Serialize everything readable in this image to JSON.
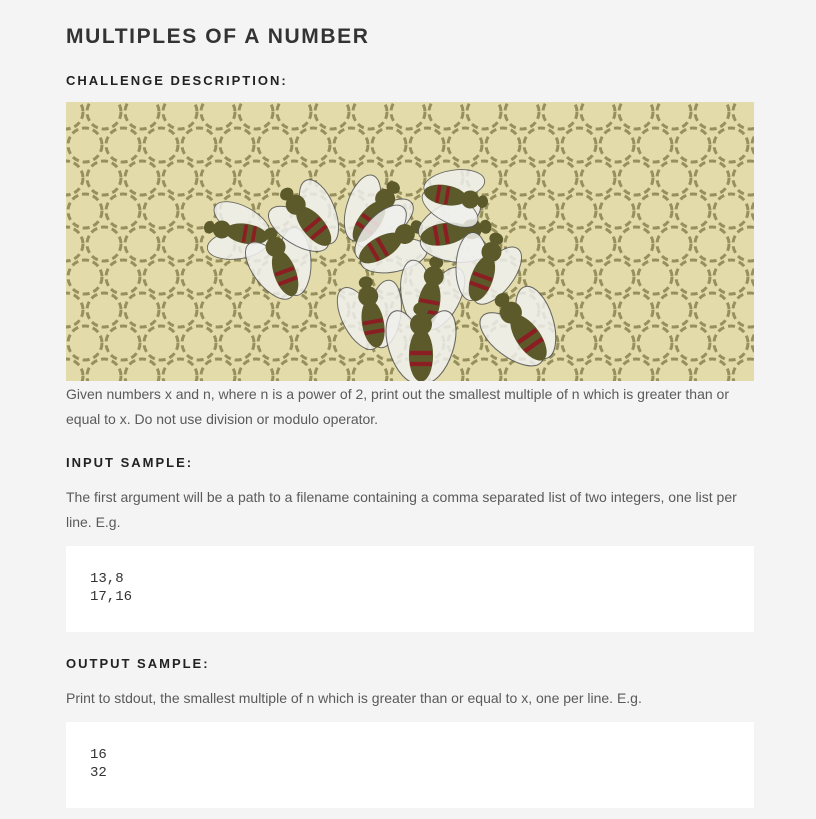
{
  "title": "MULTIPLES OF A NUMBER",
  "description": {
    "heading": "CHALLENGE DESCRIPTION:",
    "text": "Given numbers x and n, where n is a power of 2, print out the smallest multiple of n which is greater than or equal to x. Do not use division or modulo operator."
  },
  "input": {
    "heading": "INPUT SAMPLE:",
    "text": "The first argument will be a path to a filename containing a comma separated list of two integers, one list per line. E.g.",
    "lines": [
      "13,8",
      "17,16"
    ]
  },
  "output": {
    "heading": "OUTPUT SAMPLE:",
    "text": "Print to stdout, the smallest multiple of n which is greater than or equal to x, one per line. E.g.",
    "lines": [
      "16",
      "32"
    ]
  },
  "colors": {
    "page_bg": "#f4f4f4",
    "banner_bg": "#e3dcaa",
    "cell_stroke": "#8a8350",
    "bee_body": "#5c5a2a",
    "bee_stripe": "#8b1e22",
    "wing": "#f0f0ee"
  }
}
